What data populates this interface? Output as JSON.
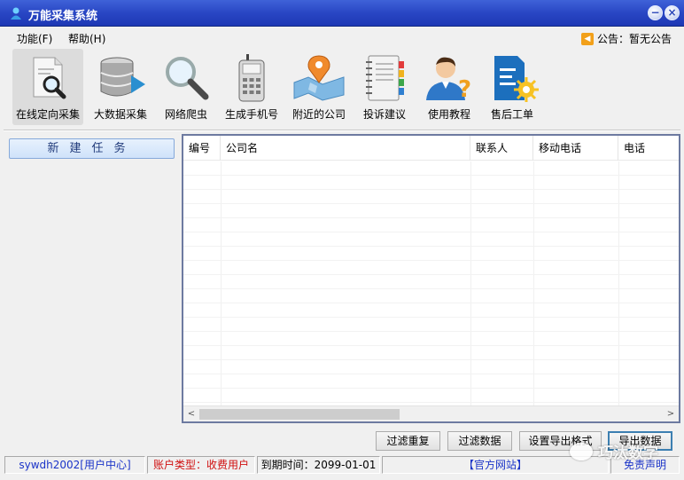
{
  "window": {
    "title": "万能采集系统",
    "minimize_glyph": "−",
    "close_glyph": "×"
  },
  "menu": {
    "items": [
      "功能(F)",
      "帮助(H)"
    ],
    "notice": "公告：暂无公告"
  },
  "toolbar": [
    {
      "label": "在线定向采集",
      "icon": "document-search-icon"
    },
    {
      "label": "大数据采集",
      "icon": "database-icon"
    },
    {
      "label": "网络爬虫",
      "icon": "magnifier-icon"
    },
    {
      "label": "生成手机号",
      "icon": "phone-icon"
    },
    {
      "label": "附近的公司",
      "icon": "map-pin-icon"
    },
    {
      "label": "投诉建议",
      "icon": "notebook-icon"
    },
    {
      "label": "使用教程",
      "icon": "user-help-icon"
    },
    {
      "label": "售后工单",
      "icon": "work-order-icon"
    }
  ],
  "left": {
    "new_task": "新建任务"
  },
  "grid": {
    "columns": [
      "编号",
      "公司名",
      "联系人",
      "移动电话",
      "电话"
    ],
    "scroll_left": "<",
    "scroll_right": ">"
  },
  "actions": [
    "过滤重复",
    "过滤数据",
    "设置导出格式",
    "导出数据"
  ],
  "status": {
    "user": "sywdh2002[用户中心]",
    "account_type": "账户类型：收费用户",
    "expiry": "到期时间：2099-01-01",
    "website": "【官方网站】",
    "disclaimer": "免责声明"
  },
  "watermark": "巧汰数字",
  "colors": {
    "title_bar": "#2946c4",
    "grid_border": "#6d7aa0",
    "link_blue": "#1b34c8",
    "warn_red": "#d01010"
  }
}
